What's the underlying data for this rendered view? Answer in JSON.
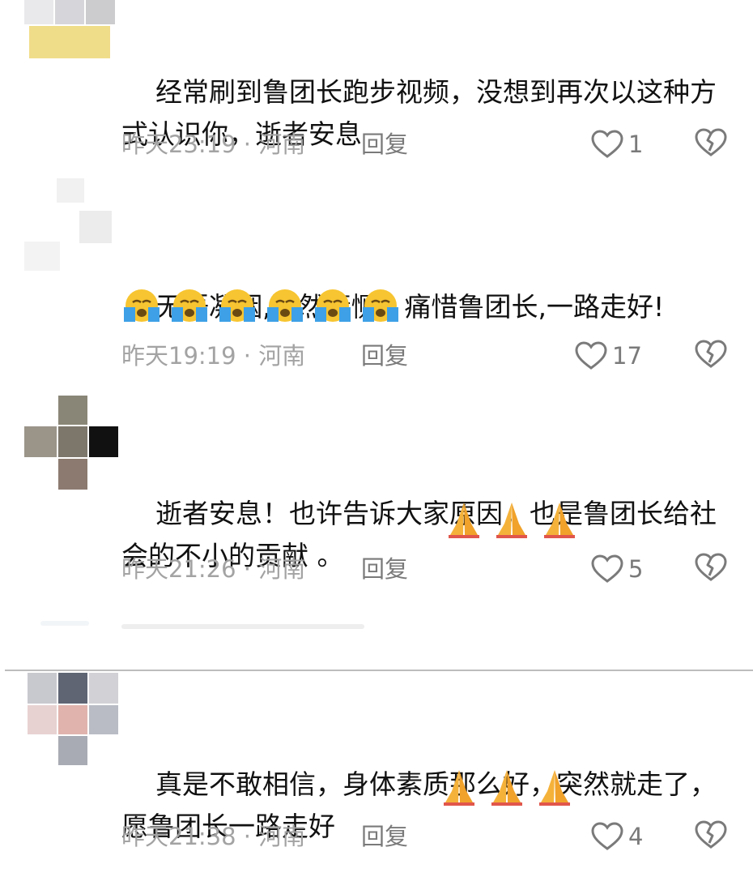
{
  "comments": [
    {
      "text": "经常刷到鲁团长跑步视频，没想到再次以这种方式认识你，逝者安息",
      "time": "昨天23:19 · 河南",
      "reply": "回复",
      "likes": "1",
      "emoji": []
    },
    {
      "text": "无语凝咽,默然凄恻。痛惜鲁团长,一路走好!",
      "time": "昨天19:19 · 河南",
      "reply": "回复",
      "likes": "17",
      "emoji": [
        "loudly-crying-face",
        "loudly-crying-face",
        "loudly-crying-face",
        "loudly-crying-face",
        "loudly-crying-face",
        "loudly-crying-face"
      ]
    },
    {
      "text": "逝者安息！也许告诉大家原因，也是鲁团长给社会的不小的贡献 。",
      "time": "昨天21:26 · 河南",
      "reply": "回复",
      "likes": "5",
      "emoji": [
        "folded-hands",
        "folded-hands",
        "folded-hands"
      ]
    },
    {
      "text": "真是不敢相信，身体素质那么好，突然就走了，愿鲁团长一路走好",
      "time": "昨天21:38 · 河南",
      "reply": "回复",
      "likes": "4",
      "emoji": [
        "folded-hands",
        "folded-hands",
        "folded-hands"
      ]
    }
  ],
  "colors": {
    "text": "#111111",
    "meta": "#a3a3a3",
    "icon": "#7a7a7a",
    "emoji_face": "#f7c531",
    "emoji_tears": "#3ea0e6",
    "emoji_hands": "#f5b23a",
    "separator": "#d8d8d8"
  },
  "avatars": {
    "c0": [
      "#ececec",
      "#d9d9d9",
      "#cfcfcf",
      "#ede6b8",
      "#f0dd8a",
      "#f2e08f"
    ],
    "c1": [
      "#f2f2f2",
      "#e9e9e9",
      "#efefef",
      "#f5f5f5"
    ],
    "c2": [
      "#9c9684",
      "#80796e",
      "#101010",
      "#9a8c80",
      "#8b7a70",
      "#c8c8c8"
    ],
    "c3": [
      "#c8c8cf",
      "#5e6472",
      "#e0b7b2",
      "#cfcfd4",
      "#a7aab3",
      "#e7d5d5"
    ]
  }
}
